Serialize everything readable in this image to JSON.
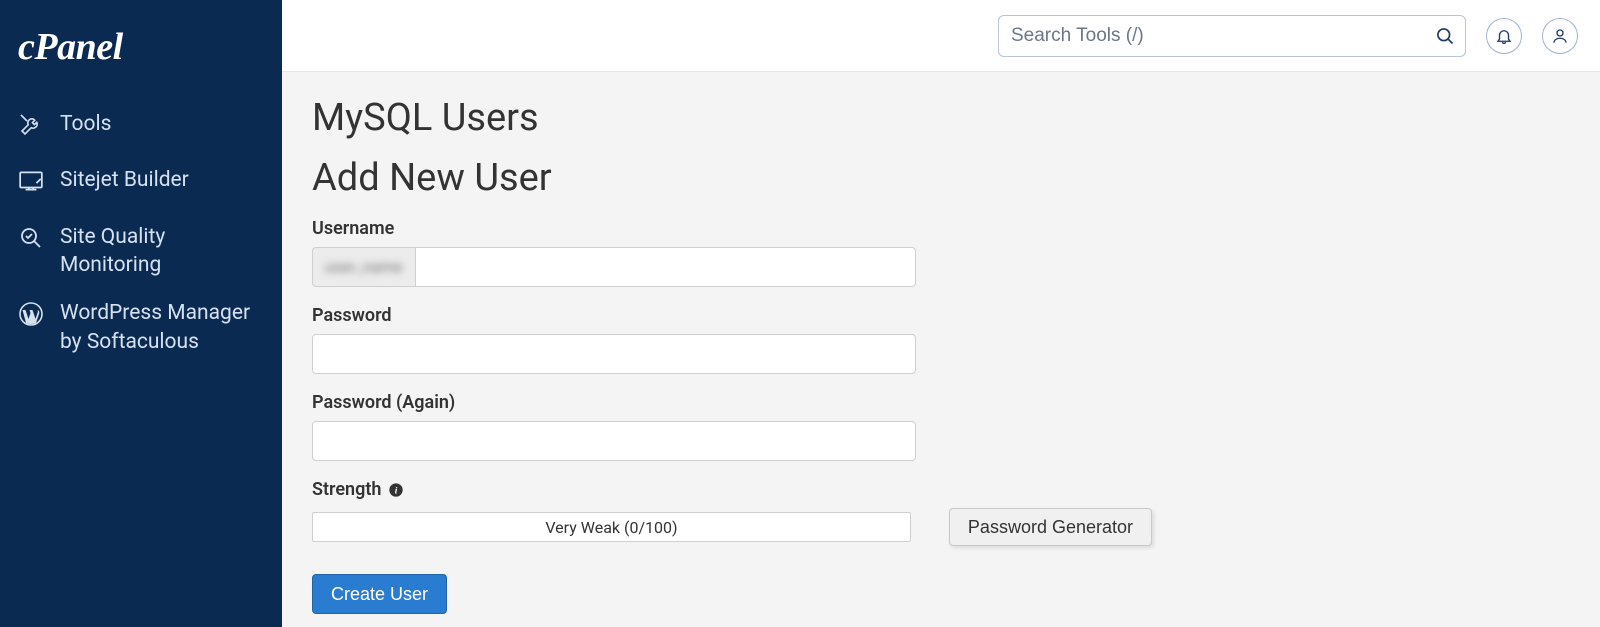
{
  "brand": "cPanel",
  "sidebar": {
    "items": [
      {
        "label": "Tools",
        "icon": "tools-icon"
      },
      {
        "label": "Sitejet Builder",
        "icon": "sitejet-icon"
      },
      {
        "label": "Site Quality Monitoring",
        "icon": "site-quality-icon"
      },
      {
        "label": "WordPress Manager by Softaculous",
        "icon": "wordpress-icon"
      }
    ]
  },
  "topbar": {
    "search_placeholder": "Search Tools (/)"
  },
  "page": {
    "title": "MySQL Users",
    "section_title": "Add New User",
    "username_label": "Username",
    "username_prefix": "user_name",
    "username_value": "",
    "password_label": "Password",
    "password_value": "",
    "password_again_label": "Password (Again)",
    "password_again_value": "",
    "strength_label": "Strength",
    "strength_text": "Very Weak (0/100)",
    "pw_generator_label": "Password Generator",
    "submit_label": "Create User"
  }
}
